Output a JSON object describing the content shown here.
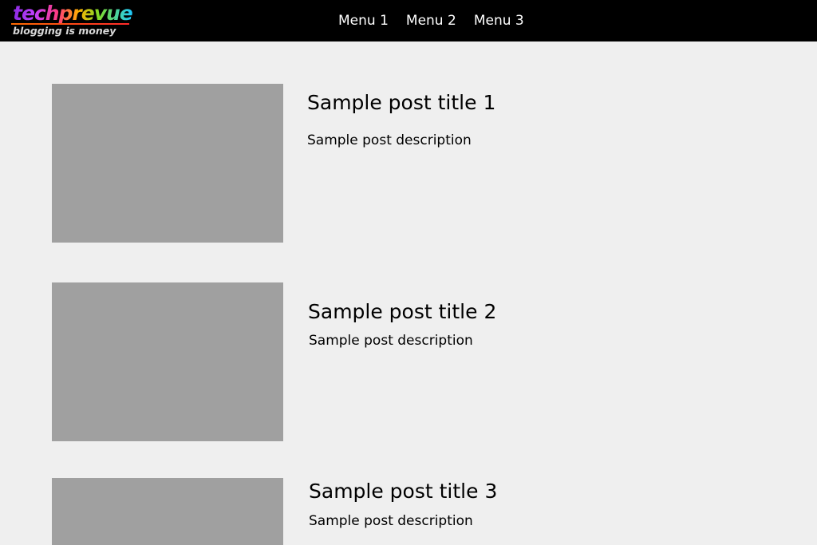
{
  "header": {
    "logo_text": "techprevue",
    "logo_tagline": "blogging is money",
    "menu": [
      {
        "label": "Menu 1"
      },
      {
        "label": "Menu 2"
      },
      {
        "label": "Menu 3"
      }
    ]
  },
  "posts": [
    {
      "title": "Sample post title 1",
      "description": "Sample post description"
    },
    {
      "title": "Sample post title 2",
      "description": "Sample post description"
    },
    {
      "title": "Sample post title 3",
      "description": "Sample post description"
    }
  ],
  "colors": {
    "header_bg": "#000000",
    "page_bg": "#efefef",
    "thumbnail_placeholder": "#a0a0a0",
    "menu_text": "#ffffff"
  }
}
